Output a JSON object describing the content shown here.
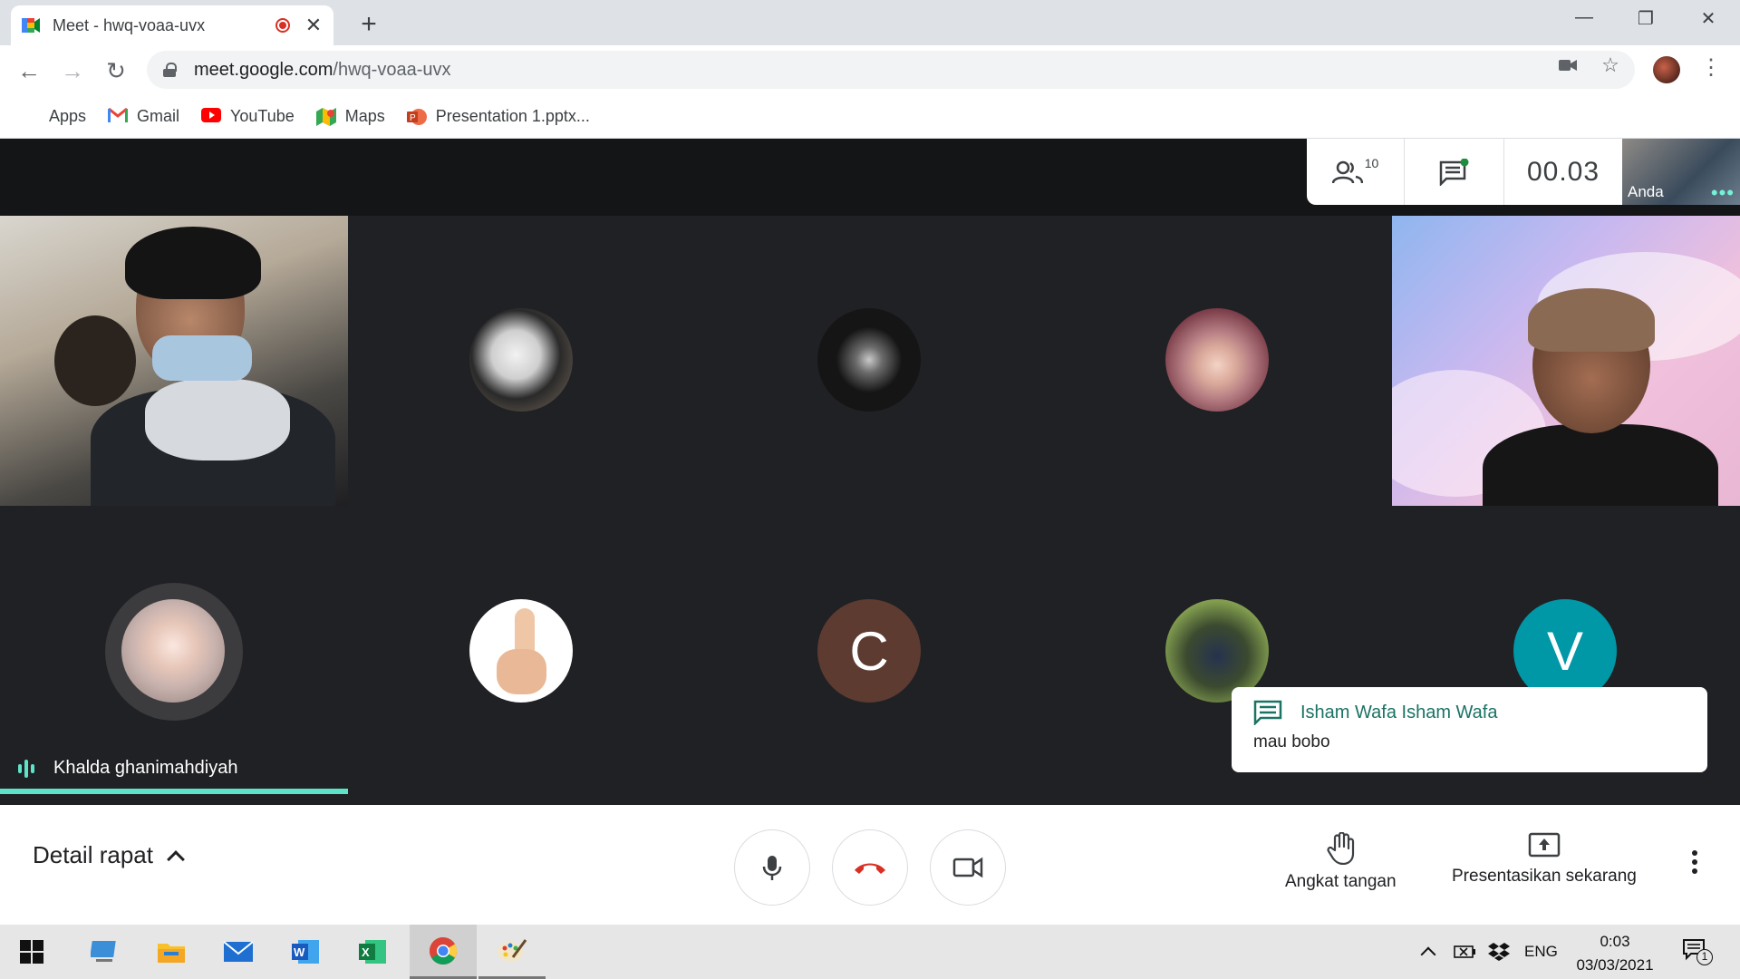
{
  "browser": {
    "tab_title": "Meet - hwq-voaa-uvx",
    "url_host": "meet.google.com",
    "url_path": "/hwq-voaa-uvx",
    "bookmarks": [
      {
        "label": "Apps",
        "icon": "apps-grid-icon"
      },
      {
        "label": "Gmail",
        "icon": "gmail-icon"
      },
      {
        "label": "YouTube",
        "icon": "youtube-icon"
      },
      {
        "label": "Maps",
        "icon": "maps-icon"
      },
      {
        "label": "Presentation 1.pptx...",
        "icon": "powerpoint-icon"
      }
    ]
  },
  "meet": {
    "participant_count": "10",
    "timer": "00.03",
    "self_label": "Anda",
    "active_speaker": "Khalda ghanimahdiyah",
    "avatar_letters": {
      "c": "C",
      "v": "V"
    },
    "chat_toast": {
      "sender": "Isham Wafa Isham Wafa",
      "message": "mau bobo"
    },
    "bottom": {
      "details_label": "Detail rapat",
      "raise_hand_label": "Angkat tangan",
      "present_label": "Presentasikan sekarang"
    }
  },
  "taskbar": {
    "language": "ENG",
    "time": "0:03",
    "date": "03/03/2021",
    "notification_count": "1"
  },
  "colors": {
    "accent_teal": "#5ce3c8",
    "hangup_red": "#d93025",
    "avatar_c": "#5d3b31",
    "avatar_v": "#0097a7"
  }
}
